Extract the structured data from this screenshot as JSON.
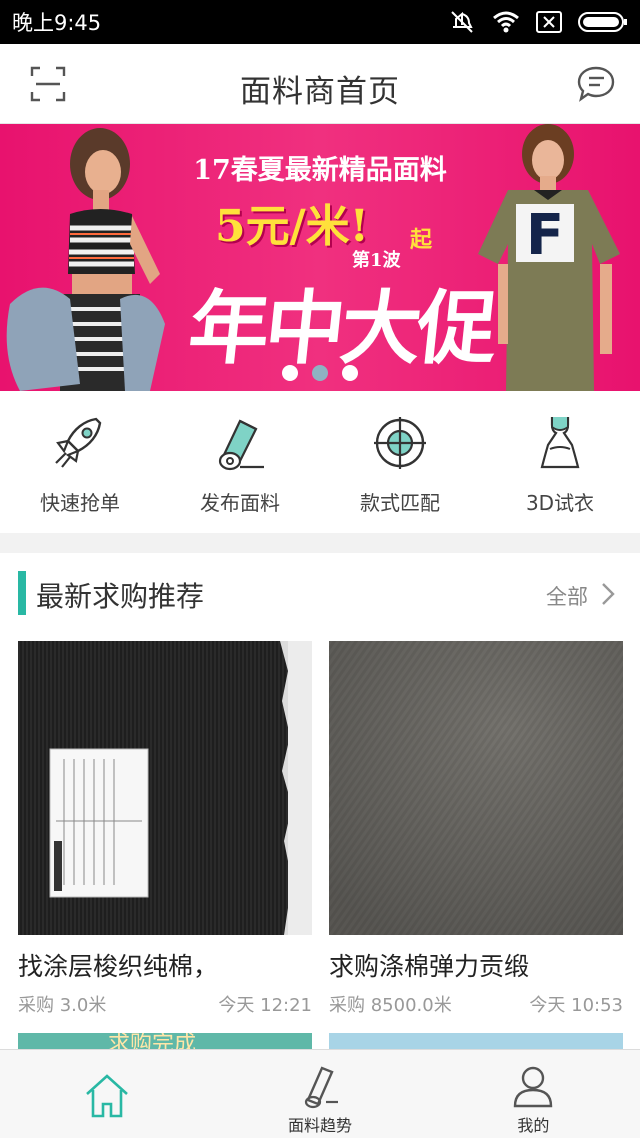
{
  "status_bar": {
    "time": "晚上9:45"
  },
  "header": {
    "title": "面料商首页",
    "scan_icon": "scan-icon",
    "message_icon": "message-icon"
  },
  "banner": {
    "line1": "17春夏最新精品面料",
    "line2": "5元/米!",
    "qi": "起",
    "wave": "第1波",
    "big": "年中大促",
    "dots_count": 3,
    "active_dot": 1,
    "color": "#e8126e"
  },
  "quick_actions": [
    {
      "label": "快速抢单",
      "icon": "rocket-icon"
    },
    {
      "label": "发布面料",
      "icon": "fabric-roll-icon"
    },
    {
      "label": "款式匹配",
      "icon": "target-icon"
    },
    {
      "label": "3D试衣",
      "icon": "dress-icon"
    }
  ],
  "section": {
    "title": "最新求购推荐",
    "all_label": "全部",
    "accent": "#29b8a4",
    "cards": [
      {
        "title": "找涂层梭织纯棉，",
        "qty": "采购 3.0米",
        "time": "今天 12:21",
        "image": "black-fabric-with-label"
      },
      {
        "title": "求购涤棉弹力贡缎",
        "qty": "采购 8500.0米",
        "time": "今天 10:53",
        "image": "grey-fabric"
      }
    ],
    "peek_text": "求购完成"
  },
  "tabbar": {
    "tabs": [
      {
        "label": "",
        "icon": "home-icon",
        "active": true
      },
      {
        "label": "面料趋势",
        "icon": "trend-icon",
        "active": false
      },
      {
        "label": "我的",
        "icon": "user-icon",
        "active": false
      }
    ],
    "active_color": "#29b8a4"
  }
}
